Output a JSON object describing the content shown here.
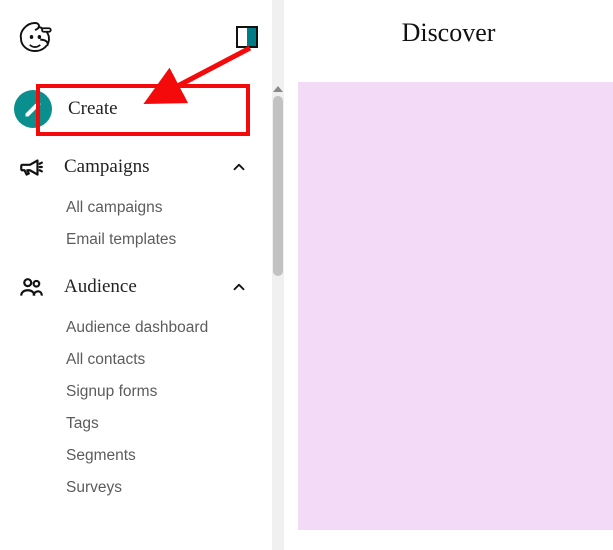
{
  "header": {
    "main_title": "Discover"
  },
  "sidebar": {
    "create_label": "Create",
    "sections": [
      {
        "label": "Campaigns",
        "items": [
          "All campaigns",
          "Email templates"
        ]
      },
      {
        "label": "Audience",
        "items": [
          "Audience dashboard",
          "All contacts",
          "Signup forms",
          "Tags",
          "Segments",
          "Surveys"
        ]
      }
    ]
  },
  "annotation": {
    "highlight_target": "create-button"
  }
}
